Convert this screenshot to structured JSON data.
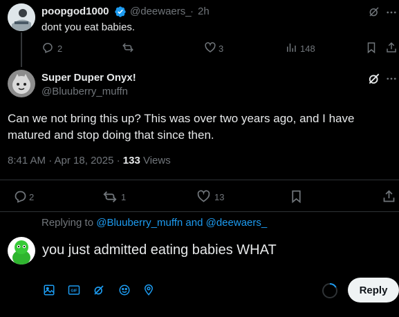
{
  "parent_tweet": {
    "display_name": "poopgod1000",
    "handle": "@deewaers_",
    "separator": "·",
    "time": "2h",
    "text": "dont you eat babies.",
    "replies": "2",
    "likes": "3",
    "views": "148"
  },
  "main_tweet": {
    "display_name": "Super Duper Onyx!",
    "handle": "@Bluuberry_muffn",
    "text": "Can we not bring this up? This was over two years ago, and I have matured and stop doing that since then.",
    "timestamp": "8:41 AM · Apr 18, 2025 ·",
    "views_count": "133",
    "views_label": "Views",
    "replies": "2",
    "reposts": "1",
    "likes": "13"
  },
  "composer": {
    "replying_to_prefix": "Replying to",
    "replying_to_user1": "@Bluuberry_muffn",
    "replying_to_and": "and",
    "replying_to_user2": "@deewaers_",
    "draft_text": "you just admitted eating babies WHAT",
    "reply_button_label": "Reply"
  },
  "colors": {
    "accent": "#1d9bf0",
    "background": "#000000",
    "muted": "#71767b",
    "divider": "#2f3336"
  },
  "icons": [
    "verified-badge-icon",
    "grok-icon",
    "more-icon",
    "reply-icon",
    "repost-icon",
    "like-icon",
    "views-icon",
    "bookmark-icon",
    "share-icon",
    "image-icon",
    "gif-icon",
    "grok-compose-icon",
    "emoji-icon",
    "location-icon",
    "progress-ring-icon"
  ]
}
